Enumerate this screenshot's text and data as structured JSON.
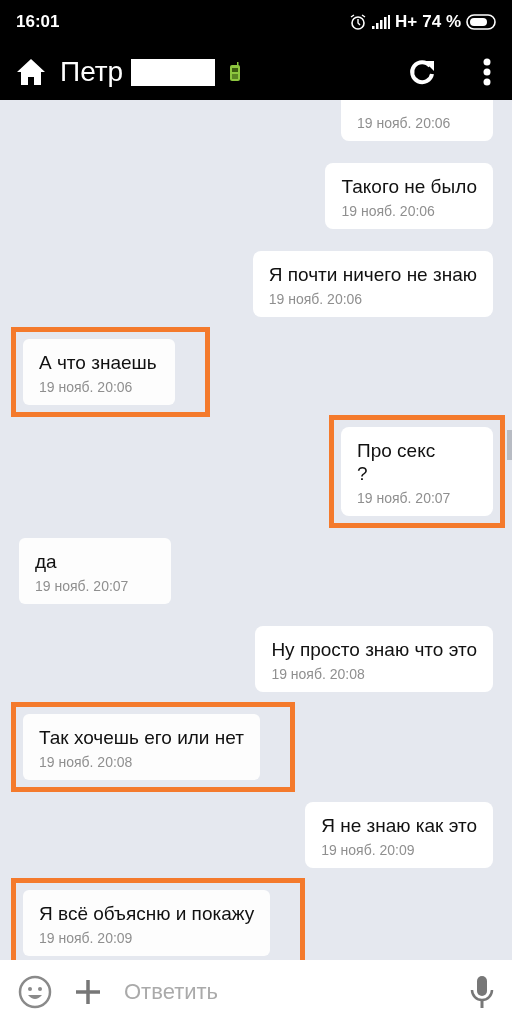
{
  "status_bar": {
    "time": "16:01",
    "network": "H+",
    "battery": "74 %"
  },
  "header": {
    "contact_name": "Петр"
  },
  "messages": [
    {
      "kind": "outgoing",
      "time": "19 нояб. 20:06",
      "highlighted": false
    },
    {
      "kind": "outgoing",
      "text": "Такого не было",
      "time": "19 нояб. 20:06",
      "highlighted": false
    },
    {
      "kind": "outgoing",
      "text": "Я почти ничего не знаю",
      "time": "19 нояб. 20:06",
      "highlighted": false
    },
    {
      "kind": "incoming",
      "text": "А что знаешь",
      "time": "19 нояб. 20:06",
      "highlighted": true
    },
    {
      "kind": "outgoing",
      "text": "Про секс\n?",
      "time": "19 нояб. 20:07",
      "highlighted": true
    },
    {
      "kind": "incoming",
      "text": "да",
      "time": "19 нояб. 20:07",
      "highlighted": false
    },
    {
      "kind": "outgoing",
      "text": "Ну просто знаю что это",
      "time": "19 нояб. 20:08",
      "highlighted": false
    },
    {
      "kind": "incoming",
      "text": "Так хочешь его или нет",
      "time": "19 нояб. 20:08",
      "highlighted": true
    },
    {
      "kind": "outgoing",
      "text": "Я не знаю как это",
      "time": "19 нояб. 20:09",
      "highlighted": false
    },
    {
      "kind": "incoming",
      "text": "Я всё объясню и покажу",
      "time": "19 нояб. 20:09",
      "highlighted": true
    }
  ],
  "composer": {
    "placeholder": "Ответить"
  }
}
